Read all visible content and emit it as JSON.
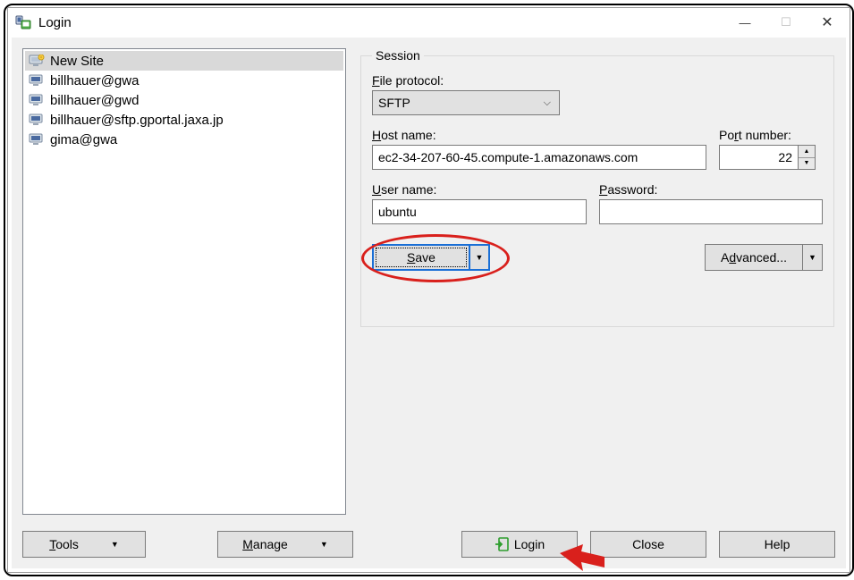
{
  "window": {
    "title": "Login"
  },
  "sites": [
    {
      "label": "New Site",
      "selected": true,
      "special": true
    },
    {
      "label": "billhauer@gwa"
    },
    {
      "label": "billhauer@gwd"
    },
    {
      "label": "billhauer@sftp.gportal.jaxa.jp"
    },
    {
      "label": "gima@gwa"
    }
  ],
  "session": {
    "legend": "Session",
    "protocol_label": "File protocol:",
    "protocol_value": "SFTP",
    "host_label": "Host name:",
    "host_value": "ec2-34-207-60-45.compute-1.amazonaws.com",
    "port_label": "Port number:",
    "port_value": "22",
    "user_label": "User name:",
    "user_value": "ubuntu",
    "pass_label": "Password:",
    "pass_value": "",
    "save_label": "Save",
    "advanced_label": "Advanced..."
  },
  "footer": {
    "tools_label": "Tools",
    "manage_label": "Manage",
    "login_label": "Login",
    "close_label": "Close",
    "help_label": "Help"
  }
}
